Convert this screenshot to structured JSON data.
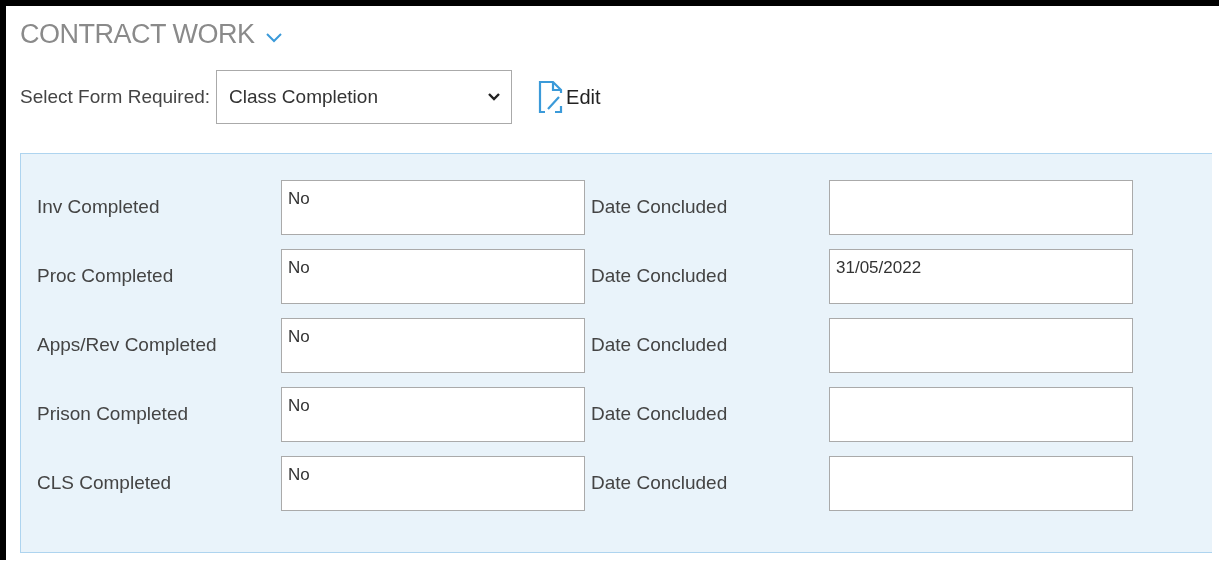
{
  "section": {
    "title": "CONTRACT WORK",
    "expanded": true
  },
  "form_select": {
    "label": "Select Form Required:",
    "value": "Class Completion"
  },
  "edit_link": {
    "label": "Edit"
  },
  "rows": [
    {
      "label": "Inv Completed",
      "value": "No",
      "date_label": "Date Concluded"
    },
    {
      "label": "Proc Completed",
      "value": "No",
      "date_label": "Date Concluded",
      "date_value": "31/05/2022"
    },
    {
      "label": "Apps/Rev Completed",
      "value": "No",
      "date_label": "Date Concluded"
    },
    {
      "label": "Prison Completed",
      "value": "No",
      "date_label": "Date Concluded"
    },
    {
      "label": "CLS Completed",
      "value": "No",
      "date_label": "Date Concluded"
    }
  ]
}
